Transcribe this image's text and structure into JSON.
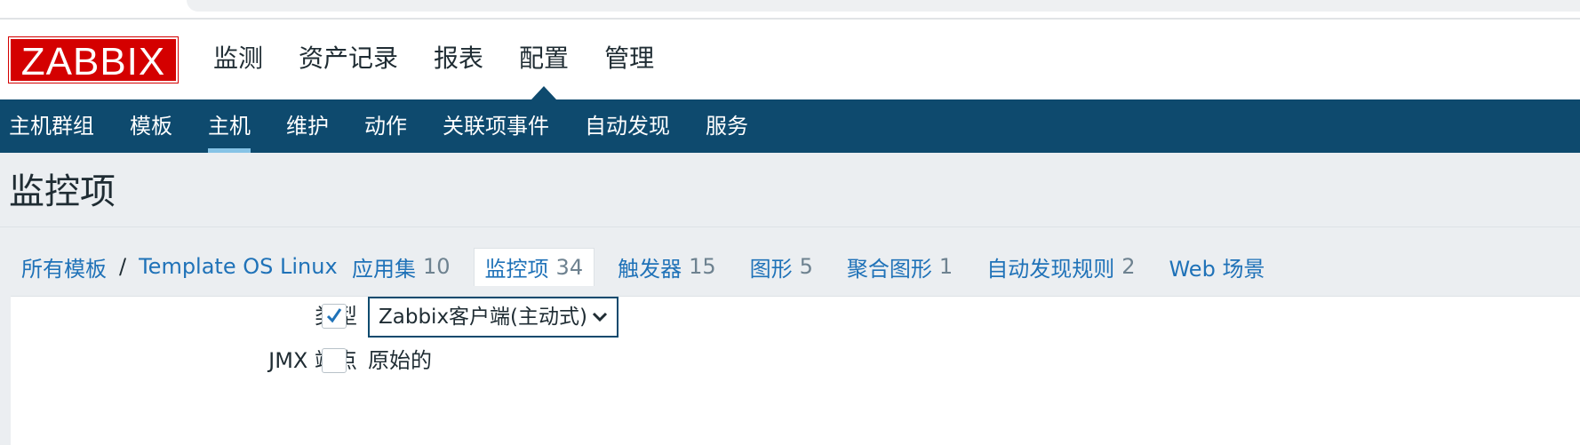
{
  "brand": {
    "logo_text": "ZABBIX",
    "color": "#d40000"
  },
  "top_menu": [
    {
      "label": "监测"
    },
    {
      "label": "资产记录"
    },
    {
      "label": "报表"
    },
    {
      "label": "配置",
      "selected": true
    },
    {
      "label": "管理"
    }
  ],
  "sub_menu": [
    {
      "label": "主机群组"
    },
    {
      "label": "模板"
    },
    {
      "label": "主机",
      "selected": true
    },
    {
      "label": "维护"
    },
    {
      "label": "动作"
    },
    {
      "label": "关联项事件"
    },
    {
      "label": "自动发现"
    },
    {
      "label": "服务"
    }
  ],
  "page_title": "监控项",
  "breadcrumb": {
    "root": "所有模板",
    "separator": "/",
    "template": "Template OS Linux"
  },
  "tabs": [
    {
      "label": "应用集",
      "count": "10"
    },
    {
      "label": "监控项",
      "count": "34",
      "active": true
    },
    {
      "label": "触发器",
      "count": "15"
    },
    {
      "label": "图形",
      "count": "5"
    },
    {
      "label": "聚合图形",
      "count": "1"
    },
    {
      "label": "自动发现规则",
      "count": "2"
    },
    {
      "label": "Web 场景",
      "count": ""
    }
  ],
  "filter": {
    "type_label": "类型",
    "type_checked": true,
    "type_value": "Zabbix客户端(主动式)",
    "jmx_label": "JMX 端点",
    "jmx_checked": false,
    "jmx_value": "原始的"
  },
  "colors": {
    "nav_bg": "#0e4a6e",
    "link": "#1f72b8",
    "count": "#6e8290",
    "page_bg": "#ebeef1"
  }
}
